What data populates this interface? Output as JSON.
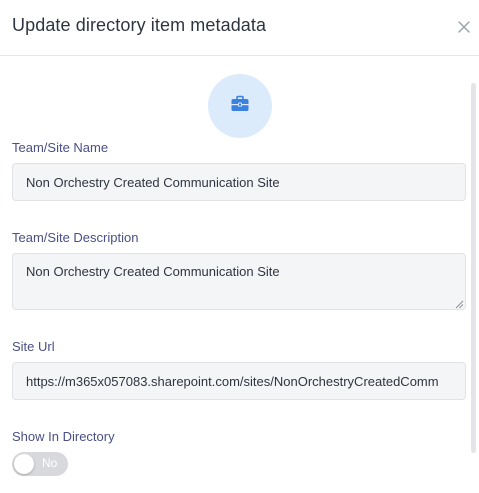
{
  "dialog": {
    "title": "Update directory item metadata",
    "close_icon": "close-icon"
  },
  "avatar": {
    "icon": "briefcase-icon",
    "background_color": "#dcebfb",
    "icon_color": "#3b82e0"
  },
  "fields": {
    "team_name": {
      "label": "Team/Site Name",
      "value": "Non Orchestry Created Communication Site"
    },
    "team_description": {
      "label": "Team/Site Description",
      "value": "Non Orchestry Created Communication Site"
    },
    "site_url": {
      "label": "Site Url",
      "value": "https://m365x057083.sharepoint.com/sites/NonOrchestryCreatedComm"
    },
    "show_in_directory": {
      "label": "Show In Directory",
      "toggle_text": "No",
      "enabled": false
    }
  },
  "colors": {
    "label": "#4a4f86",
    "title": "#2f3540",
    "input_background": "#f4f5f7",
    "toggle_off": "#d7d9dd"
  }
}
